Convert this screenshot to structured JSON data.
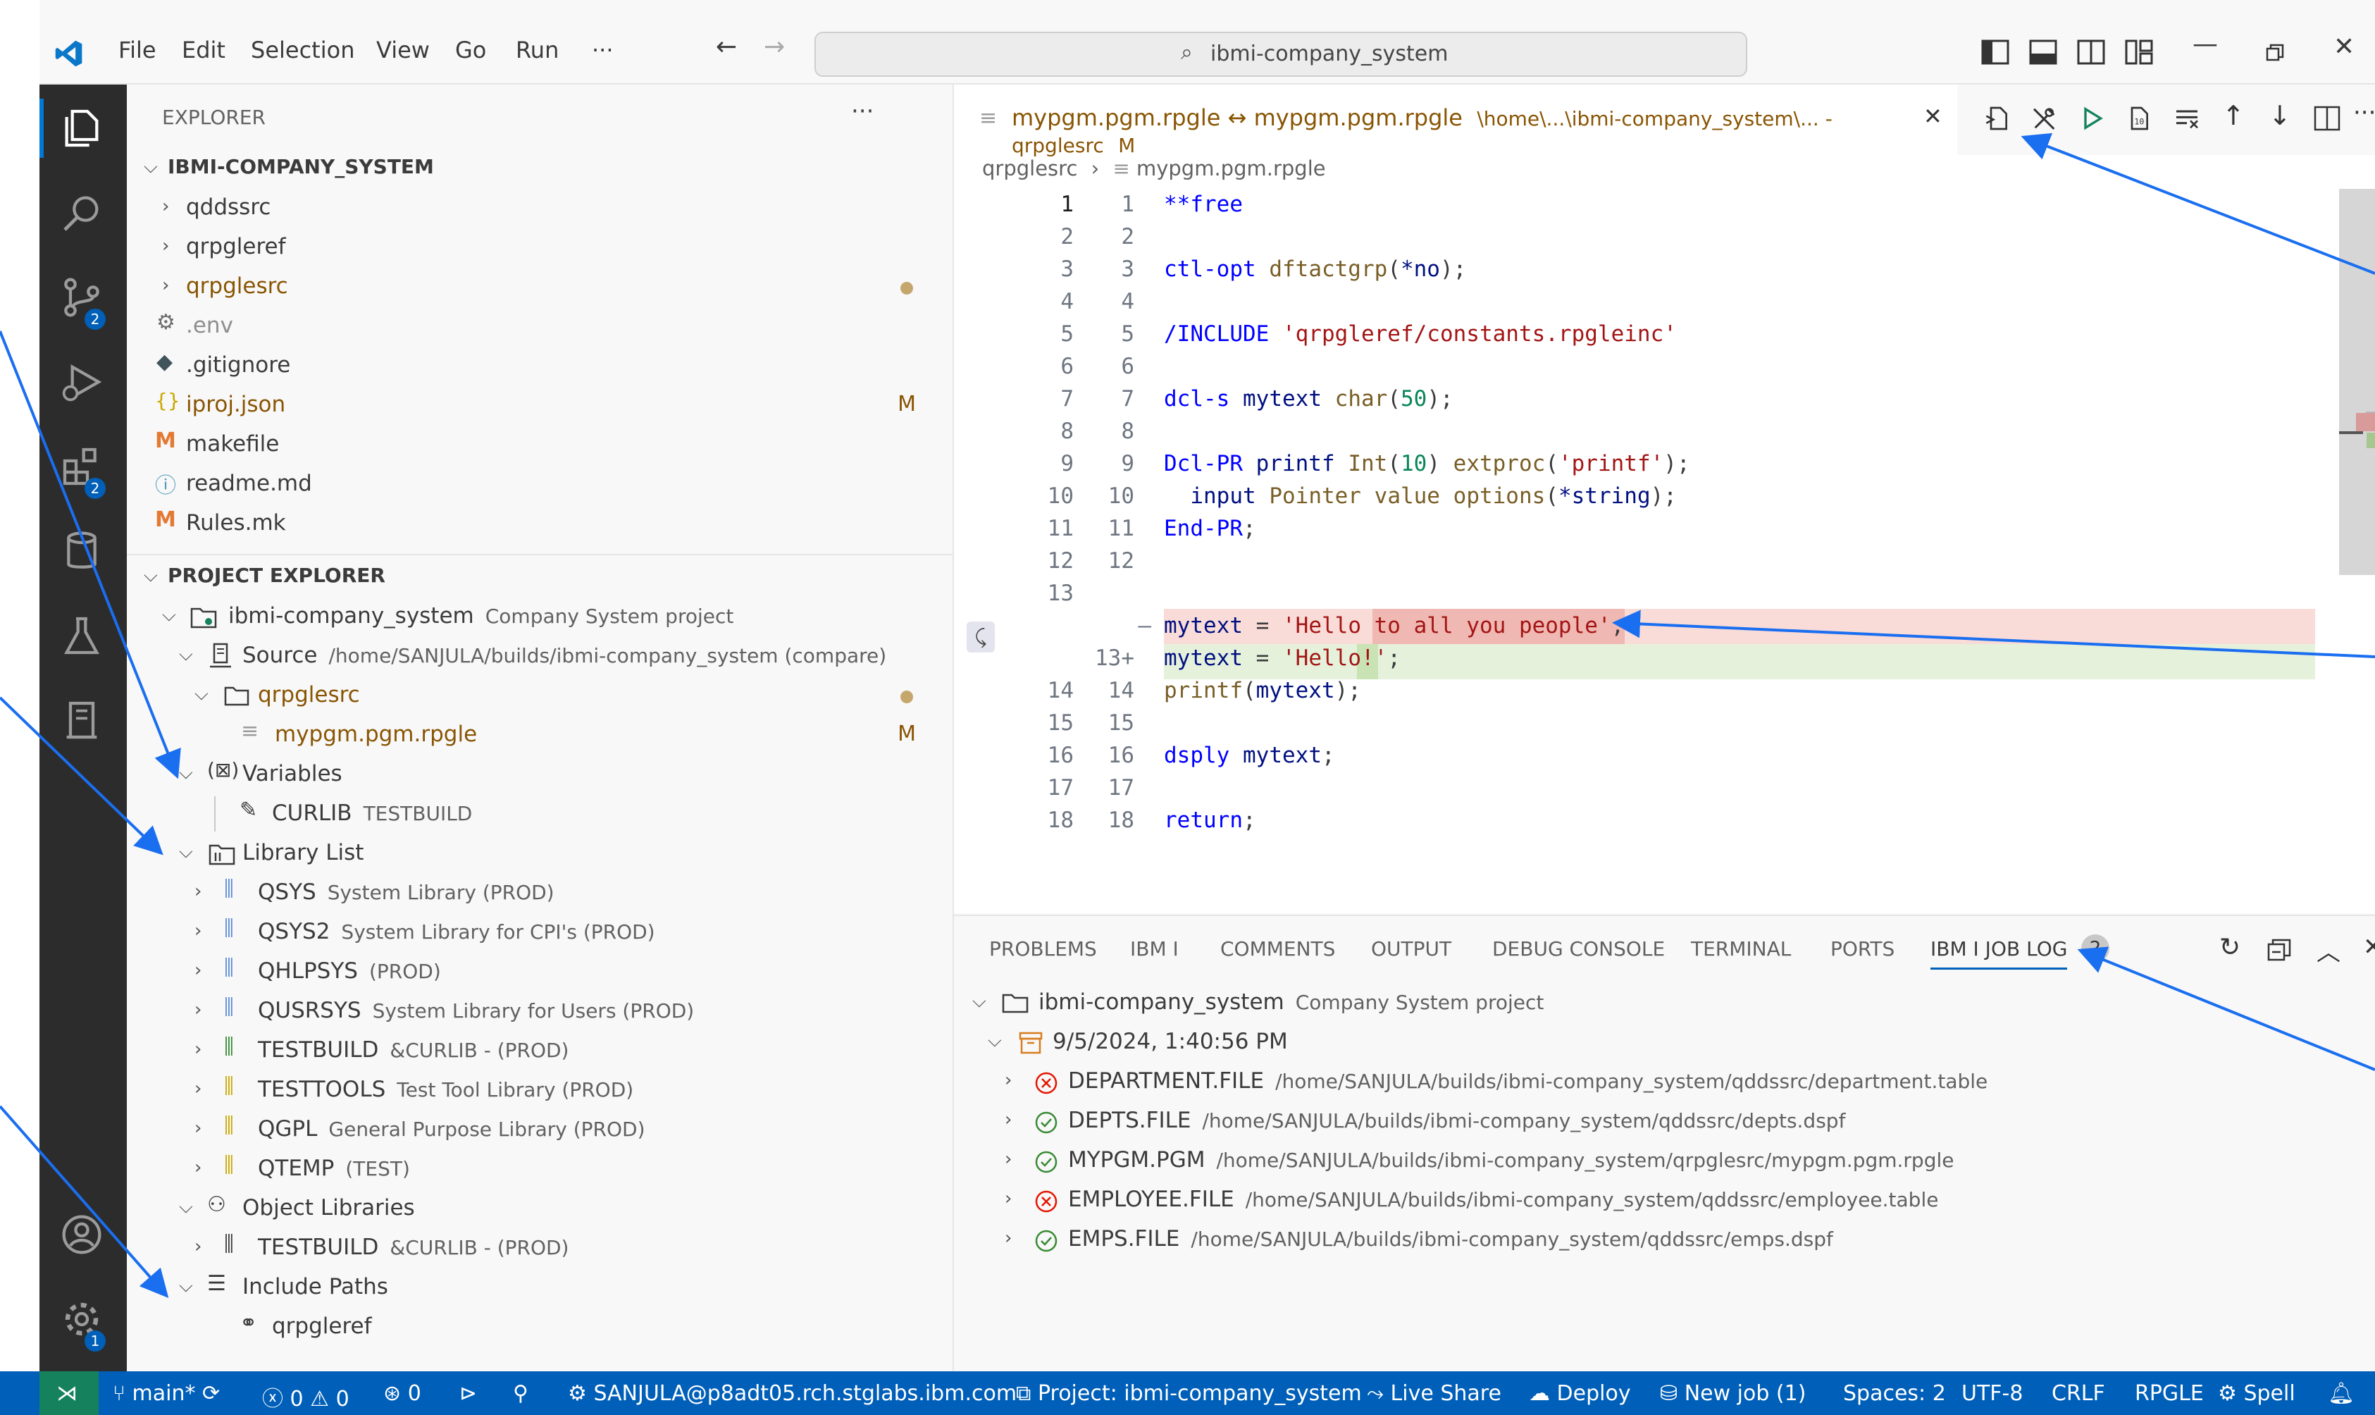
{
  "title": {
    "menu": [
      "File",
      "Edit",
      "Selection",
      "View",
      "Go",
      "Run",
      "···"
    ],
    "search": "ibmi-company_system"
  },
  "activity": {
    "scm_badge": "2",
    "ext_badge": "2",
    "settings_badge": "1"
  },
  "explorer": {
    "header": "EXPLORER",
    "workspace_title": "IBMI-COMPANY_SYSTEM",
    "files": [
      {
        "name": "qddssrc"
      },
      {
        "name": "qrpgleref"
      },
      {
        "name": "qrpglesrc"
      },
      {
        "name": ".env"
      },
      {
        "name": ".gitignore"
      },
      {
        "name": "iproj.json",
        "badge": "M"
      },
      {
        "name": "makefile"
      },
      {
        "name": "readme.md"
      },
      {
        "name": "Rules.mk"
      }
    ]
  },
  "project_explorer": {
    "title": "PROJECT EXPLORER",
    "project_name": "ibmi-company_system",
    "project_desc": "Company System project",
    "source_label": "Source",
    "source_desc": "/home/SANJULA/builds/ibmi-company_system (compare)",
    "src_folder": "qrpglesrc",
    "src_file": "mypgm.pgm.rpgle",
    "src_file_badge": "M",
    "variables_label": "Variables",
    "var_name": "CURLIB",
    "var_value": "TESTBUILD",
    "library_list_label": "Library List",
    "libraries": [
      {
        "name": "QSYS",
        "desc": "System Library (PROD)"
      },
      {
        "name": "QSYS2",
        "desc": "System Library for CPI's (PROD)"
      },
      {
        "name": "QHLPSYS",
        "desc": "(PROD)"
      },
      {
        "name": "QUSRSYS",
        "desc": "System Library for Users (PROD)"
      },
      {
        "name": "TESTBUILD",
        "desc": "&CURLIB - (PROD)"
      },
      {
        "name": "TESTTOOLS",
        "desc": "Test Tool Library (PROD)"
      },
      {
        "name": "QGPL",
        "desc": "General Purpose Library (PROD)"
      },
      {
        "name": "QTEMP",
        "desc": "(TEST)"
      }
    ],
    "object_libraries_label": "Object Libraries",
    "obj_lib_name": "TESTBUILD",
    "obj_lib_desc": "&CURLIB - (PROD)",
    "include_paths_label": "Include Paths",
    "include_path": "qrpgleref"
  },
  "editor": {
    "tab_title": "mypgm.pgm.rpgle ↔ mypgm.pgm.rpgle",
    "tab_path": "\\home\\...\\ibmi-company_system\\... - qrpglesrc",
    "tab_badge": "M",
    "breadcrumb_folder": "qrpglesrc",
    "breadcrumb_file": "mypgm.pgm.rpgle"
  },
  "panel": {
    "tabs": [
      "PROBLEMS",
      "IBM I",
      "COMMENTS",
      "OUTPUT",
      "DEBUG CONSOLE",
      "TERMINAL",
      "PORTS",
      "IBM I JOB LOG"
    ],
    "job_log_count": "2",
    "project_name": "ibmi-company_system",
    "project_desc": "Company System project",
    "timestamp": "9/5/2024, 1:40:56 PM",
    "entries": [
      {
        "name": "DEPARTMENT.FILE",
        "path": "/home/SANJULA/builds/ibmi-company_system/qddssrc/department.table",
        "status": "error"
      },
      {
        "name": "DEPTS.FILE",
        "path": "/home/SANJULA/builds/ibmi-company_system/qddssrc/depts.dspf",
        "status": "success"
      },
      {
        "name": "MYPGM.PGM",
        "path": "/home/SANJULA/builds/ibmi-company_system/qrpglesrc/mypgm.pgm.rpgle",
        "status": "success"
      },
      {
        "name": "EMPLOYEE.FILE",
        "path": "/home/SANJULA/builds/ibmi-company_system/qddssrc/employee.table",
        "status": "error"
      },
      {
        "name": "EMPS.FILE",
        "path": "/home/SANJULA/builds/ibmi-company_system/qddssrc/emps.dspf",
        "status": "success"
      }
    ]
  },
  "status": {
    "branch": "main*",
    "errors": "0",
    "warnings": "0",
    "ports": "0",
    "connection": "SANJULA@p8adt05.rch.stglabs.ibm.com",
    "project": "Project: ibmi-company_system",
    "live_share": "Live Share",
    "deploy": "Deploy",
    "new_job": "New job (1)",
    "spaces": "Spaces: 2",
    "encoding": "UTF-8",
    "eol": "CRLF",
    "language": "RPGLE",
    "spell": "Spell"
  },
  "colors": {
    "accent": "#005fb8",
    "status_bar": "#005fb8",
    "remote": "#16825d",
    "callout": "#1a6ef0",
    "removed": "#f8d3d0",
    "added": "#e5f0da"
  }
}
